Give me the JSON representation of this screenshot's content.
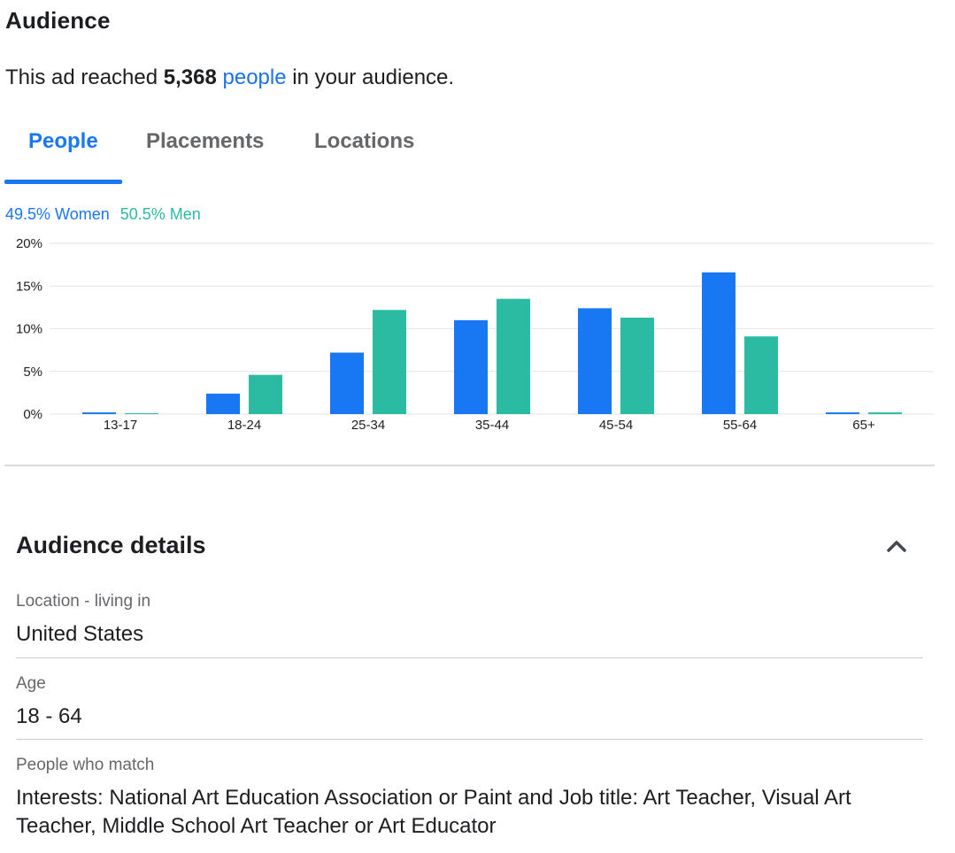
{
  "audience": {
    "title": "Audience",
    "reach_prefix": "This ad reached ",
    "reach_count": "5,368",
    "reach_link": "people",
    "reach_suffix": " in your audience."
  },
  "tabs": [
    {
      "label": "People",
      "active": true
    },
    {
      "label": "Placements",
      "active": false
    },
    {
      "label": "Locations",
      "active": false
    }
  ],
  "legend": {
    "women": "49.5% Women",
    "men": "50.5% Men"
  },
  "colors": {
    "women": "#1877f2",
    "men": "#2bbba3",
    "accent": "#1877f2"
  },
  "chart_data": {
    "type": "bar",
    "categories": [
      "13-17",
      "18-24",
      "25-34",
      "35-44",
      "45-54",
      "55-64",
      "65+"
    ],
    "series": [
      {
        "name": "Women",
        "values": [
          0.2,
          2.4,
          7.2,
          11.0,
          12.4,
          16.6,
          0.2
        ]
      },
      {
        "name": "Men",
        "values": [
          0.1,
          4.6,
          12.2,
          13.5,
          11.3,
          9.1,
          0.2
        ]
      }
    ],
    "yticks": [
      "0%",
      "5%",
      "10%",
      "15%",
      "20%"
    ],
    "ylim": [
      0,
      20
    ],
    "grid": true,
    "legend_position": "top-left"
  },
  "details": {
    "title": "Audience details",
    "collapse_icon": "chevron-up-icon",
    "fields": [
      {
        "label": "Location - living in",
        "value": "United States"
      },
      {
        "label": "Age",
        "value": "18 - 64"
      },
      {
        "label": "People who match",
        "value": "Interests: National Art Education Association or Paint and Job title: Art Teacher, Visual Art Teacher, Middle School Art Teacher or Art Educator"
      }
    ]
  }
}
